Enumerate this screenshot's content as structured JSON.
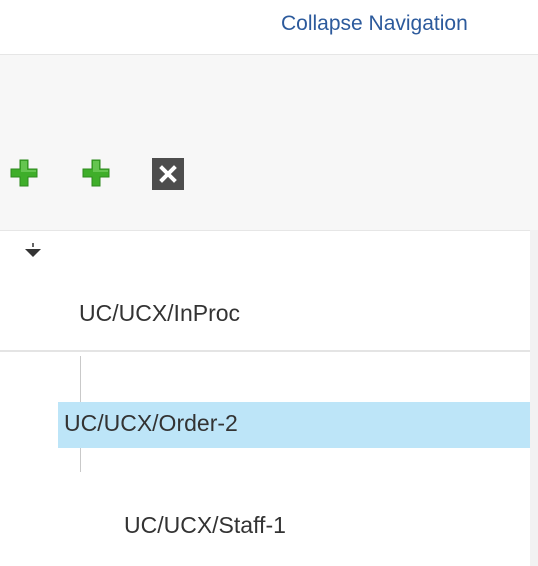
{
  "header": {
    "collapse_link": "Collapse Navigation"
  },
  "toolbar": {
    "add_root_icon": "green-plus-icon",
    "add_child_icon": "green-plus-icon",
    "delete_icon": "close-x-icon",
    "plus_color": "#3fae2a",
    "delete_bg_color": "#4d4d4d"
  },
  "tree": {
    "expand_icon": "caret-down-icon",
    "nodes": [
      {
        "label": "UC/UCX/InProc",
        "selected": false
      },
      {
        "label": "UC/UCX/Order-2",
        "selected": true
      },
      {
        "label": "UC/UCX/Staff-1",
        "selected": false
      }
    ],
    "selected_color": "#bde5f8"
  }
}
